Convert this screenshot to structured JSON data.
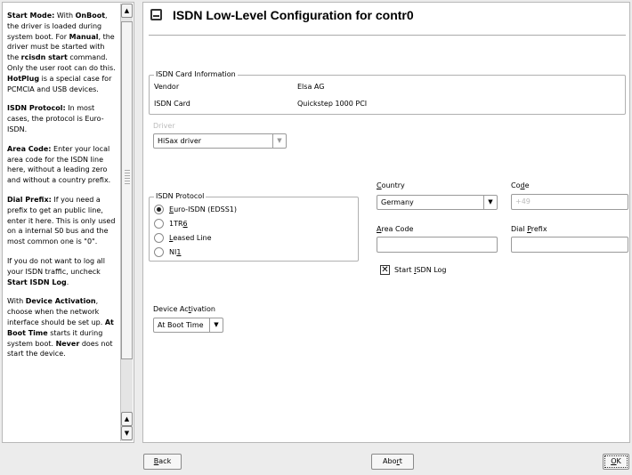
{
  "help": {
    "paragraphs": [
      [
        [
          "b",
          "Start Mode:"
        ],
        [
          "t",
          " With "
        ],
        [
          "b",
          "OnBoot"
        ],
        [
          "t",
          ", the driver is loaded during system boot. For "
        ],
        [
          "b",
          "Manual"
        ],
        [
          "t",
          ", the driver must be started with the "
        ],
        [
          "b",
          "rcisdn start"
        ],
        [
          "t",
          " command. Only the user root can do this. "
        ],
        [
          "b",
          "HotPlug"
        ],
        [
          "t",
          " is a special case for PCMCIA and USB devices."
        ]
      ],
      [
        [
          "b",
          "ISDN Protocol:"
        ],
        [
          "t",
          " In most cases, the protocol is Euro-ISDN."
        ]
      ],
      [
        [
          "b",
          "Area Code:"
        ],
        [
          "t",
          " Enter your local area code for the ISDN line here, without a leading zero and without a country prefix."
        ]
      ],
      [
        [
          "b",
          "Dial Prefix:"
        ],
        [
          "t",
          " If you need a prefix to get an public line, enter it here. This is only used on a internal S0 bus and the most common one is \"0\"."
        ]
      ],
      [
        [
          "t",
          "If you do not want to log all your ISDN traffic, uncheck "
        ],
        [
          "b",
          "Start ISDN Log"
        ],
        [
          "t",
          "."
        ]
      ],
      [
        [
          "t",
          "With "
        ],
        [
          "b",
          "Device Activation"
        ],
        [
          "t",
          ", choose when the network interface should be set up. "
        ],
        [
          "b",
          "At Boot Time"
        ],
        [
          "t",
          " starts it during system boot. "
        ],
        [
          "b",
          "Never"
        ],
        [
          "t",
          " does not start the device."
        ]
      ]
    ],
    "scroll_up_glyph": "▲",
    "scroll_down_glyph": "▼"
  },
  "main": {
    "title": "ISDN Low-Level Configuration for contr0",
    "title_icon": "phone-icon",
    "card_info": {
      "legend": "ISDN Card Information",
      "rows": [
        {
          "label": "Vendor",
          "value": "Elsa AG"
        },
        {
          "label": "ISDN Card",
          "value": "Quickstep 1000 PCI"
        }
      ]
    },
    "driver": {
      "label": "Driver",
      "value": "HiSax driver"
    },
    "protocol": {
      "legend": "ISDN Protocol",
      "options": [
        {
          "pre": "",
          "mn": "E",
          "post": "uro-ISDN (EDSS1)",
          "selected": true
        },
        {
          "pre": "1TR",
          "mn": "6",
          "post": "",
          "selected": false
        },
        {
          "pre": "",
          "mn": "L",
          "post": "eased Line",
          "selected": false
        },
        {
          "pre": "NI",
          "mn": "1",
          "post": "",
          "selected": false
        }
      ]
    },
    "country": {
      "label_mn": "C",
      "label_rest": "ountry",
      "value": "Germany"
    },
    "code": {
      "label_pre": "Co",
      "label_mn": "d",
      "label_post": "e",
      "value": "+49"
    },
    "area_code": {
      "label_mn": "A",
      "label_rest": "rea Code",
      "value": ""
    },
    "dial_prefix": {
      "label_pre": "Dial ",
      "label_mn": "P",
      "label_post": "refix",
      "value": ""
    },
    "start_log": {
      "pre": "Start ",
      "mn": "I",
      "post": "SDN Log",
      "checked": true
    },
    "activation": {
      "label_pre": "Device Ac",
      "label_mn": "t",
      "label_post": "ivation",
      "value": "At Boot Time"
    }
  },
  "buttons": {
    "back": {
      "mn": "B",
      "rest": "ack"
    },
    "abort": {
      "pre": "Abo",
      "mn": "r",
      "post": "t"
    },
    "ok": {
      "mn": "O",
      "rest": "K"
    }
  },
  "dropdown_glyph": "▼",
  "check_glyph": "✕"
}
